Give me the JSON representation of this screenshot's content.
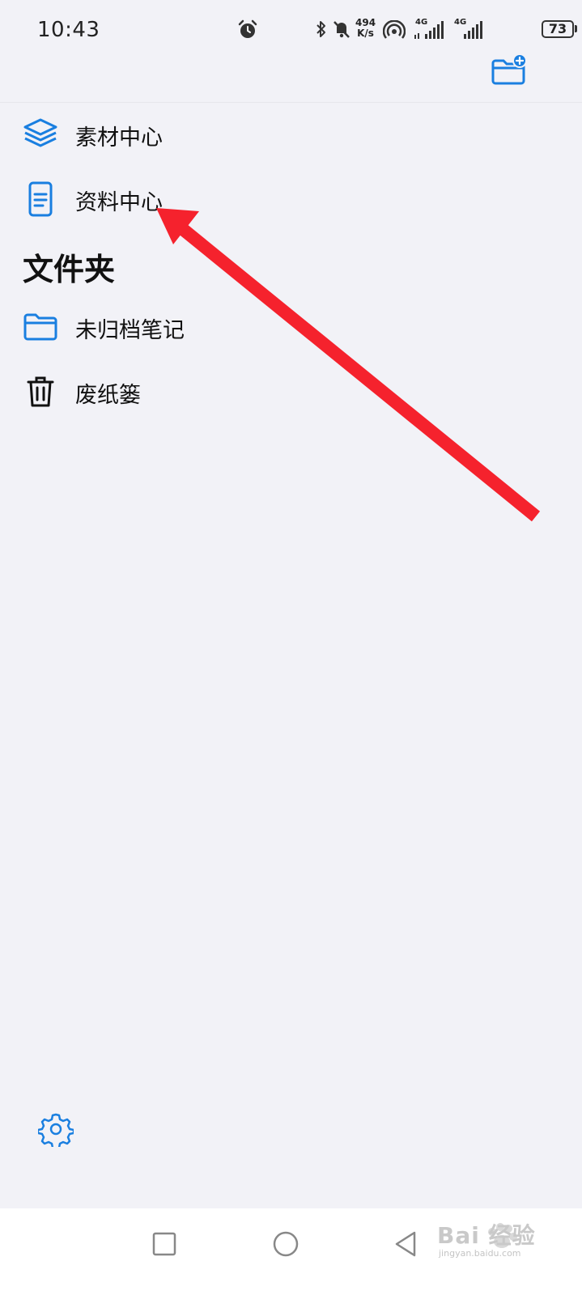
{
  "status_bar": {
    "time": "10:43",
    "net_speed_value": "494",
    "net_speed_unit": "K/s",
    "sig1_label": "4G",
    "sig2_label": "4G",
    "battery": "73"
  },
  "menu": {
    "items": [
      {
        "label": "素材中心",
        "icon": "layers-icon"
      },
      {
        "label": "资料中心",
        "icon": "document-icon"
      }
    ],
    "folders_title": "文件夹",
    "folders": [
      {
        "label": "未归档笔记",
        "icon": "folder-icon"
      },
      {
        "label": "废纸篓",
        "icon": "trash-icon"
      }
    ]
  },
  "watermark": {
    "text": "Bai 经验",
    "sub": "jingyan.baidu.com"
  },
  "colors": {
    "accent": "#1a7fe0",
    "background": "#f2f2f7",
    "annotation_arrow": "#f5222d"
  }
}
